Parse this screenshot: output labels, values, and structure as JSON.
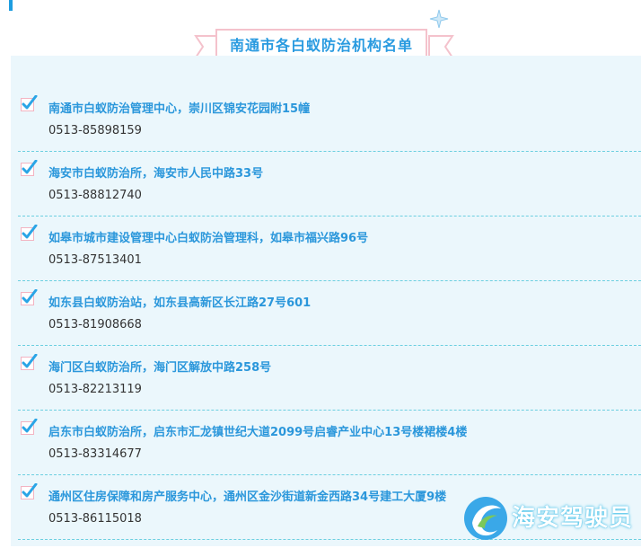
{
  "title": "南通市各白蚁防治机构名单",
  "items": [
    {
      "name": "南通市白蚁防治管理中心，崇川区锦安花园附15幢",
      "phone": "0513-85898159"
    },
    {
      "name": "海安市白蚁防治所，海安市人民中路33号",
      "phone": "0513-88812740"
    },
    {
      "name": "如皋市城市建设管理中心白蚁防治管理科，如皋市福兴路96号",
      "phone": "0513-87513401"
    },
    {
      "name": "如东县白蚁防治站，如东县高新区长江路27号601",
      "phone": "0513-81908668"
    },
    {
      "name": "海门区白蚁防治所，海门区解放中路258号",
      "phone": "0513-82213119"
    },
    {
      "name": "启东市白蚁防治所，启东市汇龙镇世纪大道2099号启睿产业中心13号楼裙楼4楼",
      "phone": "0513-83314677"
    },
    {
      "name": "通州区住房保障和房产服务中心，通州区金沙街道新金西路34号建工大厦9楼",
      "phone": "0513-86115018"
    }
  ],
  "watermark": {
    "text": "海安驾驶员"
  },
  "colors": {
    "accent": "#2b97db",
    "panel": "#ebf7fc",
    "check": "#2aa5e6",
    "title_border": "#f4c2cc",
    "divider": "#6ccfe0"
  }
}
